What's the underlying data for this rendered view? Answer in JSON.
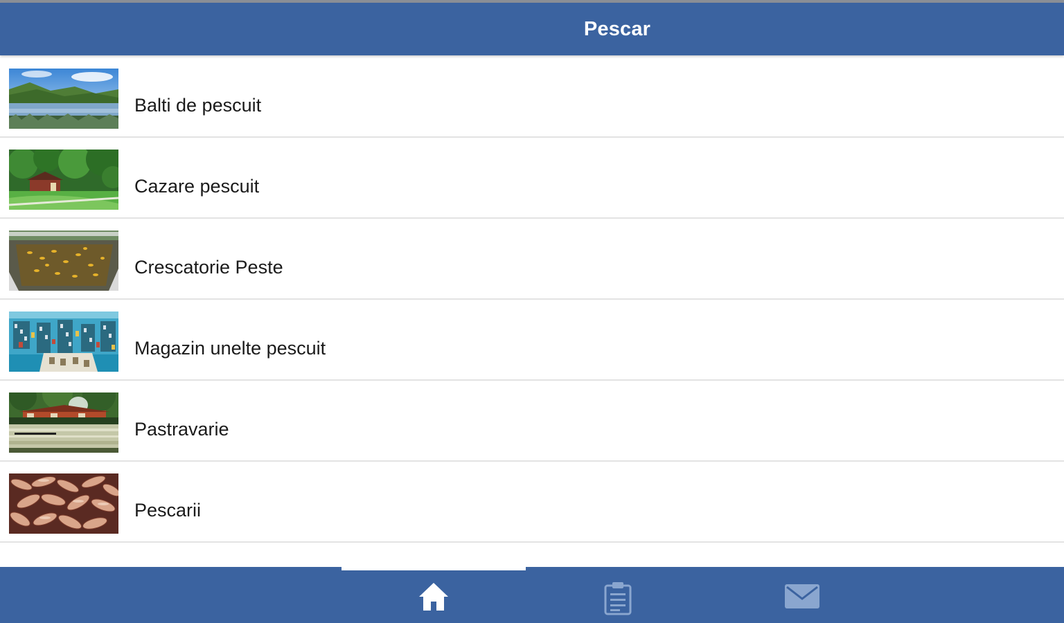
{
  "header": {
    "title": "Pescar"
  },
  "list": {
    "items": [
      {
        "label": "Balti de pescuit",
        "thumbnail": "lake-landscape-thumbnail"
      },
      {
        "label": "Cazare pescuit",
        "thumbnail": "forest-cabin-thumbnail"
      },
      {
        "label": "Crescatorie Peste",
        "thumbnail": "fish-tank-thumbnail"
      },
      {
        "label": "Magazin unelte pescuit",
        "thumbnail": "tackle-shop-thumbnail"
      },
      {
        "label": "Pastravarie",
        "thumbnail": "trout-farm-thumbnail"
      },
      {
        "label": "Pescarii",
        "thumbnail": "fish-market-thumbnail"
      }
    ]
  },
  "tabbar": {
    "tabs": [
      {
        "icon": "home-icon",
        "active": true
      },
      {
        "icon": "clipboard-icon",
        "active": false
      },
      {
        "icon": "envelope-icon",
        "active": false
      }
    ]
  },
  "colors": {
    "primary": "#3b63a0",
    "header_text": "#ffffff",
    "item_text": "#1b1b1b",
    "divider": "#e3e3e3"
  }
}
